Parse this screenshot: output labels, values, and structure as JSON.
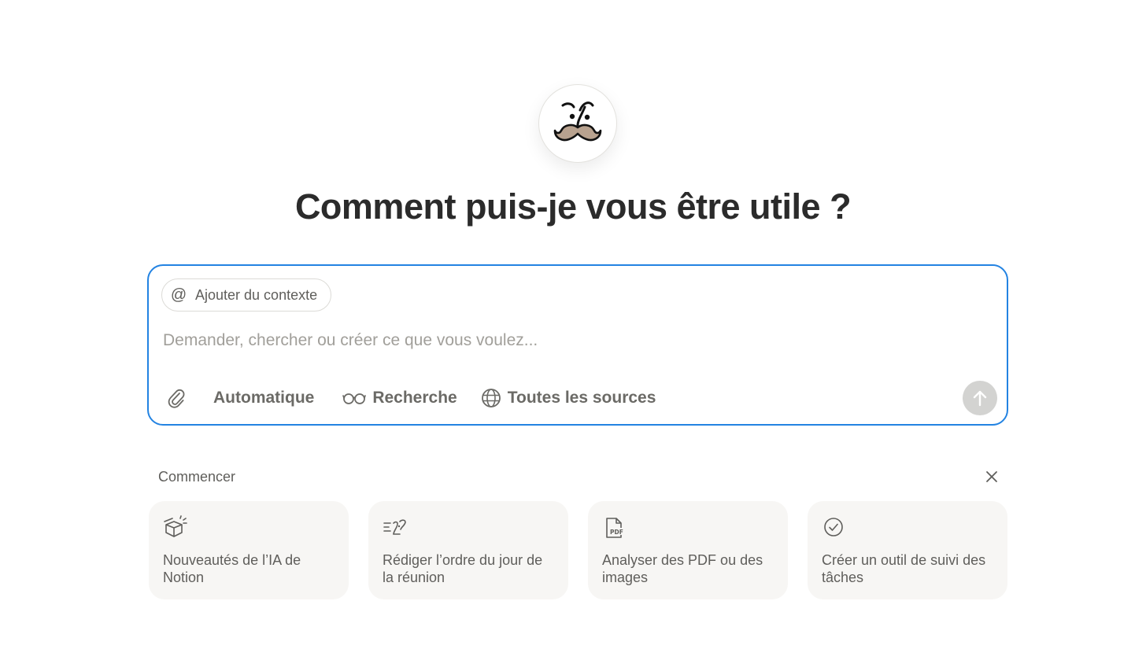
{
  "header": {
    "avatar_icon": "notion-ai-face-icon",
    "title": "Comment puis-je vous être utile ?"
  },
  "composer": {
    "context_chip": {
      "icon": "at-sign-icon",
      "at_symbol": "@",
      "label": "Ajouter du contexte"
    },
    "input": {
      "value": "",
      "placeholder": "Demander, chercher ou créer ce que vous voulez..."
    },
    "toolbar": {
      "attach_icon": "paperclip-icon",
      "mode_label": "Automatique",
      "research_icon": "glasses-icon",
      "research_label": "Recherche",
      "sources_icon": "globe-icon",
      "sources_label": "Toutes les sources"
    },
    "send_icon": "arrow-up-icon"
  },
  "getting_started": {
    "label": "Commencer",
    "close_icon": "close-icon",
    "cards": [
      {
        "icon": "gift-box-sparkle-icon",
        "label": "Nouveautés de l’IA de Notion"
      },
      {
        "icon": "agenda-list-icon",
        "label": "Rédiger l’ordre du jour de la réunion"
      },
      {
        "icon": "pdf-file-icon",
        "label": "Analyser des PDF ou des images"
      },
      {
        "icon": "check-circle-icon",
        "label": "Créer un outil de suivi des tâches"
      }
    ]
  },
  "colors": {
    "accent": "#2383e2",
    "card_bg": "#f7f6f4",
    "send_disabled": "#d3d3d1",
    "mustache": "#b8a28f"
  }
}
